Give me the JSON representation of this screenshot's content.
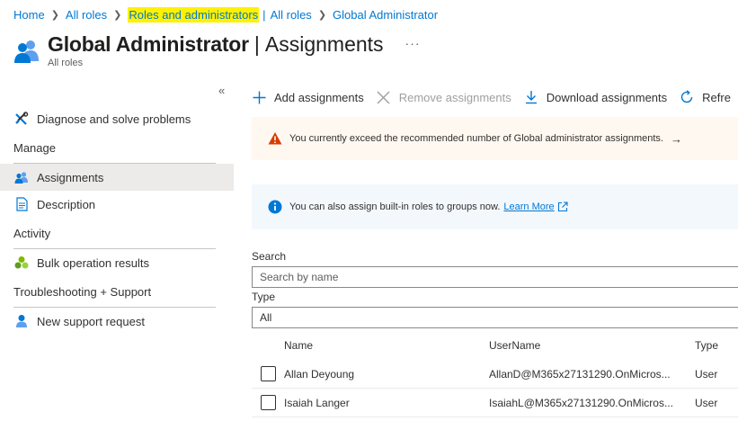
{
  "breadcrumb": {
    "items": [
      "Home",
      "All roles",
      "Roles and administrators",
      "All roles",
      "Global Administrator"
    ],
    "pipe": "|"
  },
  "header": {
    "title": "Global Administrator",
    "separator": "|",
    "subtitle": "Assignments",
    "sub_label": "All roles",
    "more": "···"
  },
  "collapse_icon": "«",
  "sidebar": {
    "items": [
      {
        "label": "Diagnose and solve problems",
        "icon": "wrench-icon"
      },
      {
        "label": "Assignments",
        "icon": "users-icon",
        "active": true
      },
      {
        "label": "Description",
        "icon": "document-icon"
      },
      {
        "label": "Bulk operation results",
        "icon": "bulk-icon"
      },
      {
        "label": "New support request",
        "icon": "support-person-icon"
      }
    ],
    "sections": [
      "Manage",
      "Activity",
      "Troubleshooting + Support"
    ]
  },
  "toolbar": {
    "add": "Add assignments",
    "remove": "Remove assignments",
    "download": "Download assignments",
    "refresh": "Refre"
  },
  "warning": {
    "text": "You currently exceed the recommended number of Global administrator assignments.",
    "arrow": "→"
  },
  "info": {
    "text": "You can also assign built-in roles to groups now.",
    "link": "Learn More"
  },
  "search": {
    "label": "Search",
    "placeholder": "Search by name"
  },
  "type_filter": {
    "label": "Type",
    "value": "All"
  },
  "table": {
    "columns": [
      "Name",
      "UserName",
      "Type"
    ],
    "rows": [
      {
        "name": "Allan Deyoung",
        "username": "AllanD@M365x27131290.OnMicros...",
        "type": "User"
      },
      {
        "name": "Isaiah Langer",
        "username": "IsaiahL@M365x27131290.OnMicros...",
        "type": "User"
      }
    ]
  },
  "colors": {
    "accent": "#0078d4",
    "highlight": "#fff100",
    "warning": "#d83b01",
    "active_nav": "#edebe9"
  }
}
